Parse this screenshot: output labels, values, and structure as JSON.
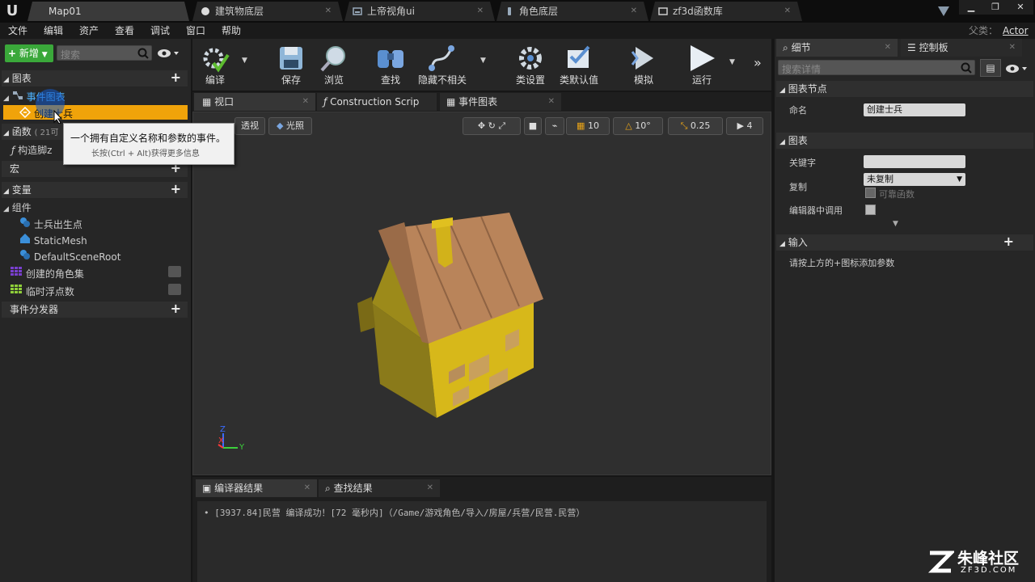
{
  "titlebar": {
    "tabs": [
      {
        "label": "Map01"
      },
      {
        "label": "建筑物底层"
      },
      {
        "label": "上帝视角ui"
      },
      {
        "label": "角色底层"
      },
      {
        "label": "zf3d函数库"
      }
    ]
  },
  "menubar": {
    "items": [
      "文件",
      "编辑",
      "资产",
      "查看",
      "调试",
      "窗口",
      "帮助"
    ],
    "parent_label": "父类：",
    "parent_value": "Actor"
  },
  "mybp": {
    "new_label": "新增",
    "search_placeholder": "搜索",
    "graphs_label": "图表",
    "event_graph_label": "事件图表",
    "selected_event": "创建士兵",
    "functions_label": "函数",
    "functions_count": "( 21可",
    "construct_label": "构造脚z",
    "macros_label": "宏",
    "variables_label": "变量",
    "components_label": "组件",
    "components": [
      "士兵出生点",
      "StaticMesh",
      "DefaultSceneRoot"
    ],
    "vars": [
      "创建的角色集",
      "临时浮点数"
    ],
    "dispatchers_label": "事件分发器"
  },
  "tooltip": {
    "line1": "一个拥有自定义名称和参数的事件。",
    "line2": "长按(Ctrl + Alt)获得更多信息"
  },
  "toolbar": {
    "compile": "编译",
    "save": "保存",
    "browse": "浏览",
    "find": "查找",
    "hide": "隐藏不相关",
    "class_settings": "类设置",
    "class_defaults": "类默认值",
    "simulate": "模拟",
    "play": "运行"
  },
  "doc_tabs": {
    "viewport": "视口",
    "construction": "Construction Scrip",
    "event_graph": "事件图表"
  },
  "viewport": {
    "perspective": "透视",
    "lit": "光照",
    "grid_size": "10",
    "rot_snap": "10°",
    "scale_snap": "0.25",
    "cam_speed": "4",
    "axis_z": "Z",
    "axis_x": "X",
    "axis_y": "Y"
  },
  "bottom": {
    "tab_compiler": "编译器结果",
    "tab_find": "查找结果",
    "log": "[3937.84]民营 编译成功！[72 毫秒内]（/Game/游戏角色/导入/房屋/兵营/民营.民营）"
  },
  "details": {
    "tab_details": "细节",
    "tab_palette": "控制板",
    "search_placeholder": "搜索详情",
    "graph_node_section": "图表节点",
    "name_label": "命名",
    "name_value": "创建士兵",
    "graph_section": "图表",
    "keywords_label": "关键字",
    "replication_label": "复制",
    "replication_value": "未复制",
    "reliable_label": "可靠函数",
    "call_in_editor_label": "编辑器中调用",
    "inputs_section": "输入",
    "inputs_hint": "请按上方的+图标添加参数"
  },
  "watermark": {
    "brand": "朱峰社区",
    "url": "ZF3D.COM"
  },
  "colors": {
    "accent_orange": "#e8a317",
    "selected_row": "#f0a30a",
    "add_green": "#3aa83a"
  }
}
